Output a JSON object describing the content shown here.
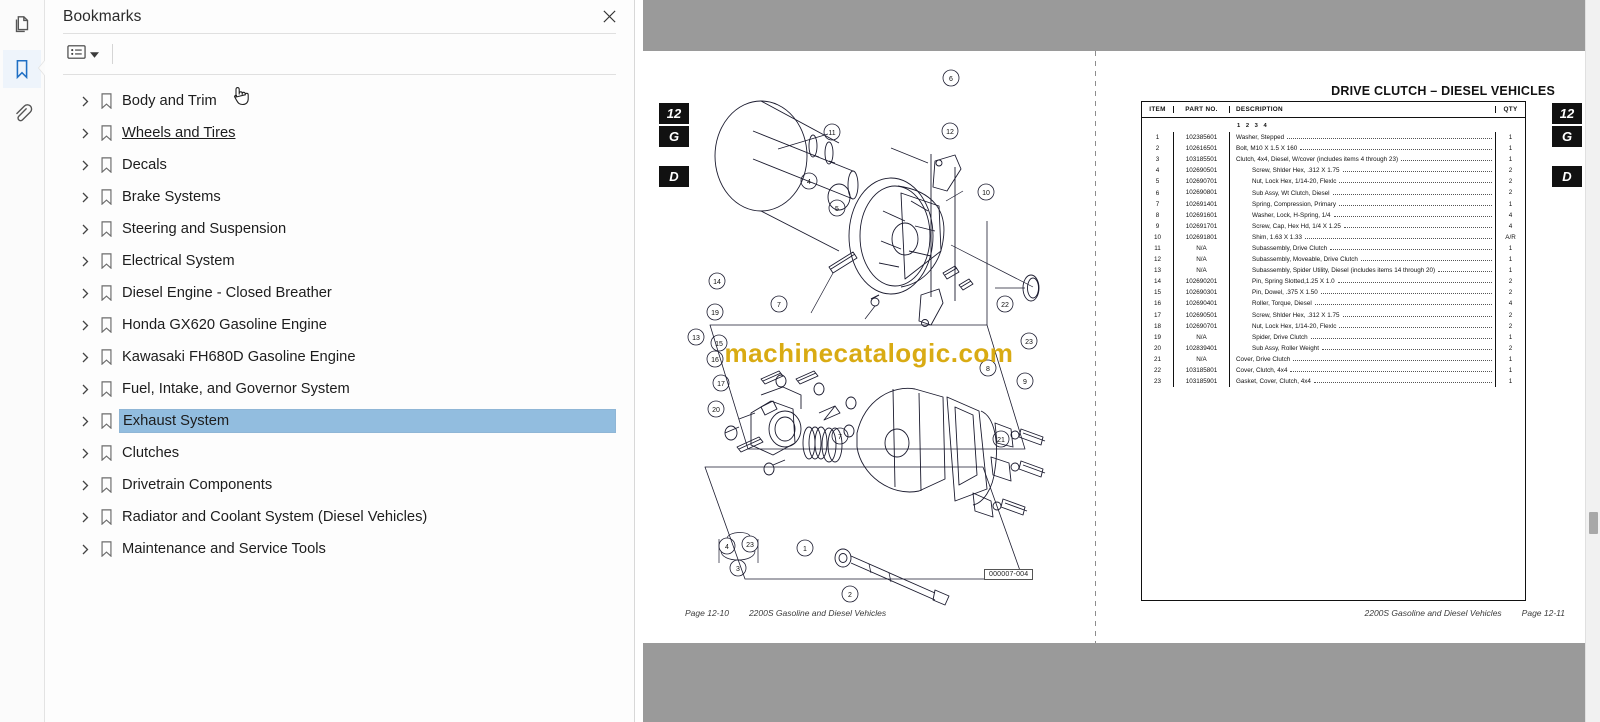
{
  "rail": {
    "items": [
      {
        "name": "page-thumbnails-icon",
        "label": "Page Thumbnails",
        "active": false
      },
      {
        "name": "bookmarks-icon",
        "label": "Bookmarks",
        "active": true
      },
      {
        "name": "attachments-icon",
        "label": "Attachments",
        "active": false
      }
    ]
  },
  "panel": {
    "title": "Bookmarks",
    "close_label": "✕",
    "options_icon": "list-options-icon",
    "dropdown_icon": "chevron-down-icon",
    "bookmarks": [
      {
        "label": "Body and Trim",
        "selected": false,
        "underline": false
      },
      {
        "label": "Wheels and Tires",
        "selected": false,
        "underline": true
      },
      {
        "label": "Decals",
        "selected": false,
        "underline": false
      },
      {
        "label": "Brake Systems",
        "selected": false,
        "underline": false
      },
      {
        "label": "Steering and Suspension",
        "selected": false,
        "underline": false
      },
      {
        "label": "Electrical System",
        "selected": false,
        "underline": false
      },
      {
        "label": "Diesel Engine - Closed Breather",
        "selected": false,
        "underline": false
      },
      {
        "label": "Honda GX620 Gasoline Engine",
        "selected": false,
        "underline": false
      },
      {
        "label": "Kawasaki FH680D Gasoline Engine",
        "selected": false,
        "underline": false
      },
      {
        "label": "Fuel, Intake, and Governor System",
        "selected": false,
        "underline": false
      },
      {
        "label": "Exhaust System",
        "selected": true,
        "underline": false
      },
      {
        "label": "Clutches",
        "selected": false,
        "underline": false
      },
      {
        "label": "Drivetrain Components",
        "selected": false,
        "underline": false
      },
      {
        "label": "Radiator and Coolant System (Diesel Vehicles)",
        "selected": false,
        "underline": false
      },
      {
        "label": "Maintenance and Service Tools",
        "selected": false,
        "underline": false
      }
    ]
  },
  "document": {
    "watermark": "machinecatalogic.com",
    "left_page": {
      "index_tabs": [
        "12",
        "G",
        "D"
      ],
      "drawing_number": "000007-004",
      "footer_page": "Page 12-10",
      "footer_title": "2200S Gasoline and Diesel Vehicles",
      "callouts": [
        "11",
        "6",
        "12",
        "4",
        "10",
        "5",
        "14",
        "19",
        "13",
        "15",
        "16",
        "17",
        "20",
        "7",
        "22",
        "23",
        "8",
        "9",
        "21",
        "1",
        "2",
        "4",
        "23",
        "3"
      ]
    },
    "right_page": {
      "index_tabs": [
        "12",
        "G",
        "D"
      ],
      "title": "DRIVE CLUTCH – DIESEL VEHICLES",
      "footer_title": "2200S Gasoline and Diesel Vehicles",
      "footer_page": "Page 12-11",
      "columns": [
        "ITEM",
        "PART NO.",
        "DESCRIPTION",
        "QTY"
      ],
      "legend": "1  2  3  4",
      "rows": [
        {
          "item": "1",
          "part": "102385601",
          "desc": "Washer, Stepped",
          "indent": false,
          "qty": "1"
        },
        {
          "item": "2",
          "part": "102616501",
          "desc": "Bolt, M10 X 1.5 X 160",
          "indent": false,
          "qty": "1"
        },
        {
          "item": "3",
          "part": "103185501",
          "desc": "Clutch, 4x4, Diesel, W/cover (includes items 4 through 23)",
          "indent": false,
          "qty": "1"
        },
        {
          "item": "4",
          "part": "102690501",
          "desc": "Screw, Shlder Hex, .312 X 1.75",
          "indent": true,
          "qty": "2"
        },
        {
          "item": "5",
          "part": "102690701",
          "desc": "Nut, Lock Hex, 1/14-20, Flexlc",
          "indent": true,
          "qty": "2"
        },
        {
          "item": "6",
          "part": "102690801",
          "desc": "Sub Assy, Wt Clutch, Diesel",
          "indent": true,
          "qty": "2"
        },
        {
          "item": "7",
          "part": "102691401",
          "desc": "Spring, Compression, Primary",
          "indent": true,
          "qty": "1"
        },
        {
          "item": "8",
          "part": "102691601",
          "desc": "Washer, Lock, H-Spring, 1/4",
          "indent": true,
          "qty": "4"
        },
        {
          "item": "9",
          "part": "102691701",
          "desc": "Screw, Cap, Hex Hd, 1/4 X 1.25",
          "indent": true,
          "qty": "4"
        },
        {
          "item": "10",
          "part": "102691801",
          "desc": "Shim, 1.63 X 1.33",
          "indent": true,
          "qty": "A/R"
        },
        {
          "item": "11",
          "part": "N/A",
          "desc": "Subassembly, Drive Clutch",
          "indent": true,
          "qty": "1"
        },
        {
          "item": "12",
          "part": "N/A",
          "desc": "Subassembly, Moveable, Drive Clutch",
          "indent": true,
          "qty": "1"
        },
        {
          "item": "13",
          "part": "N/A",
          "desc": "Subassembly, Spider Utility, Diesel (includes items 14 through 20)",
          "indent": true,
          "qty": "1"
        },
        {
          "item": "14",
          "part": "102690201",
          "desc": "Pin, Spring Slotted,1.25 X 1.0",
          "indent": true,
          "qty": "2"
        },
        {
          "item": "15",
          "part": "102690301",
          "desc": "Pin, Dowel, .375 X 1.50",
          "indent": true,
          "qty": "2"
        },
        {
          "item": "16",
          "part": "102690401",
          "desc": "Roller, Torque, Diesel",
          "indent": true,
          "qty": "4"
        },
        {
          "item": "17",
          "part": "102690501",
          "desc": "Screw, Shlder Hex, .312 X 1.75",
          "indent": true,
          "qty": "2"
        },
        {
          "item": "18",
          "part": "102690701",
          "desc": "Nut, Lock Hex, 1/14-20, Flexlc",
          "indent": true,
          "qty": "2"
        },
        {
          "item": "19",
          "part": "N/A",
          "desc": "Spider, Drive Clutch",
          "indent": true,
          "qty": "1"
        },
        {
          "item": "20",
          "part": "102839401",
          "desc": "Sub Assy, Roller Weight",
          "indent": true,
          "qty": "2"
        },
        {
          "item": "21",
          "part": "N/A",
          "desc": "Cover, Drive Clutch",
          "indent": false,
          "qty": "1"
        },
        {
          "item": "22",
          "part": "103185801",
          "desc": "Cover, Clutch, 4x4",
          "indent": false,
          "qty": "1"
        },
        {
          "item": "23",
          "part": "103185901",
          "desc": "Gasket, Cover, Clutch, 4x4",
          "indent": false,
          "qty": "1"
        }
      ]
    }
  },
  "colors": {
    "selection": "#92bddf",
    "accent": "#1f6fc4",
    "watermark": "#d6a400",
    "band": "#9a9a9a"
  }
}
